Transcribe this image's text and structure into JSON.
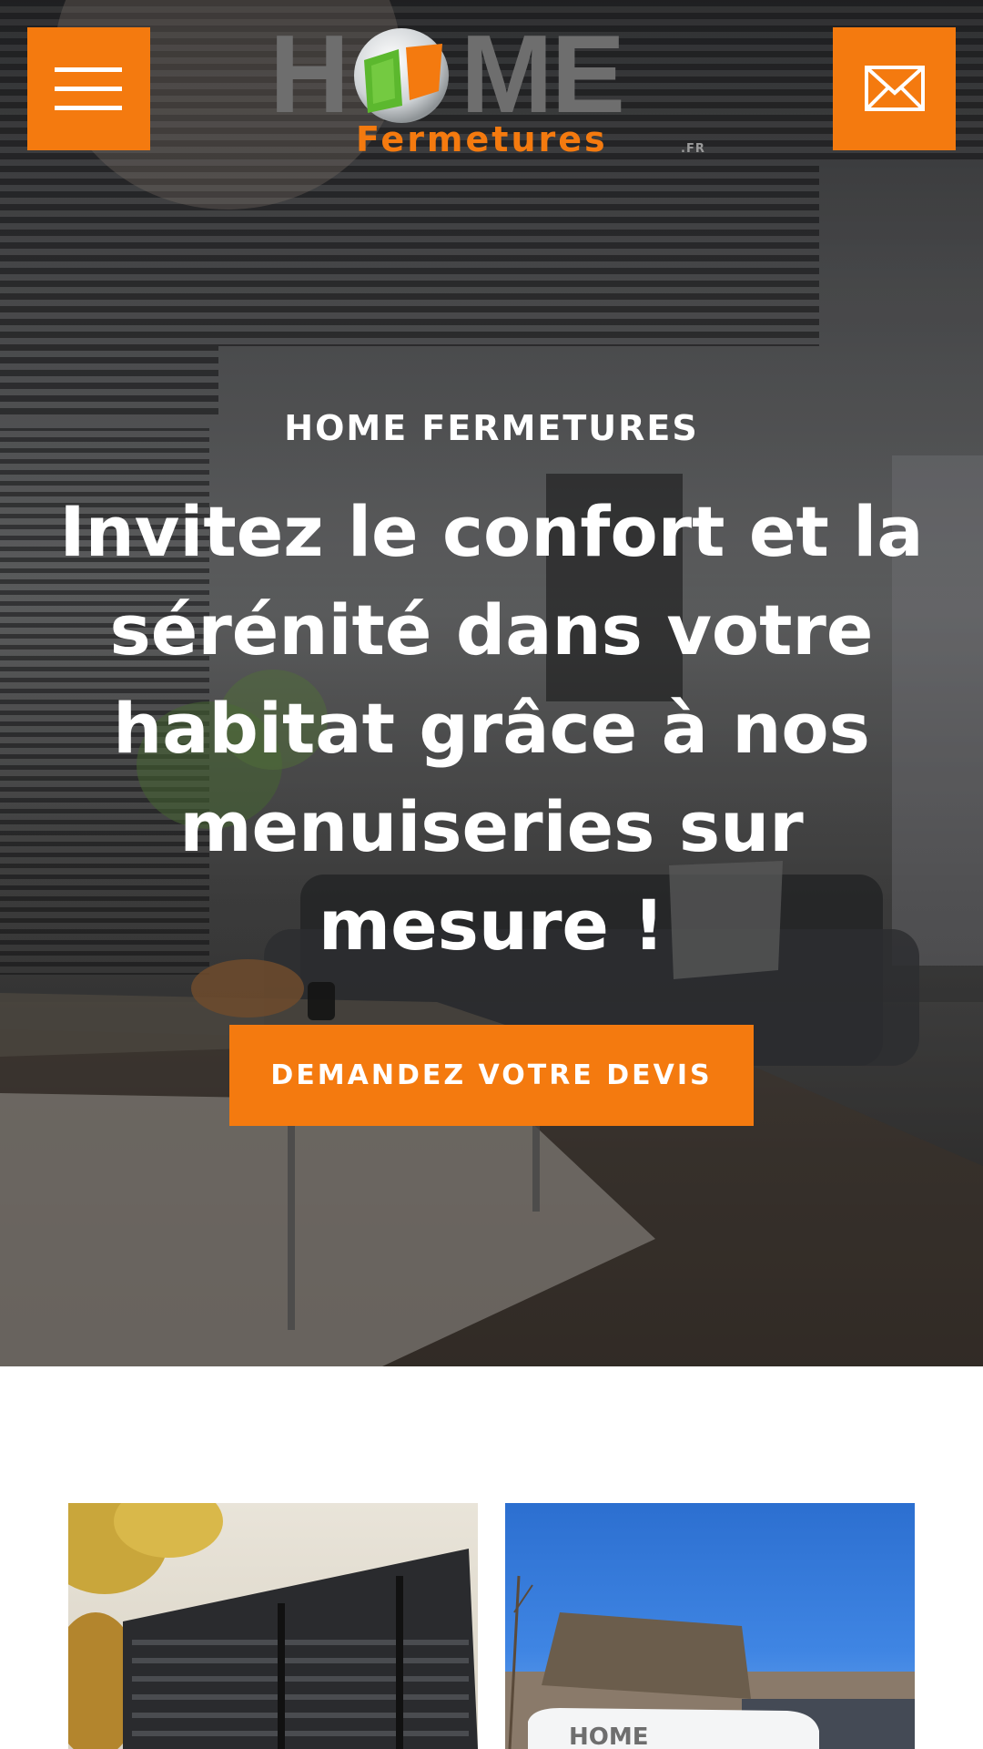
{
  "header": {
    "menu_icon": "hamburger-icon",
    "mail_icon": "envelope-icon",
    "logo": {
      "brand_home": "HOME",
      "brand_sub": "Fermetures",
      "brand_tld": ".FR"
    }
  },
  "hero": {
    "eyebrow": "HOME FERMETURES",
    "headline": "Invitez le confort et la sérénité dans votre habitat grâce à nos menuiseries sur mesure !",
    "cta_label": "DEMANDEZ VOTRE DEVIS"
  },
  "colors": {
    "accent": "#f47a0f",
    "logo_gray": "#6e6e6e",
    "text_on_hero": "#ffffff"
  },
  "cards": [
    {
      "image": "shutters-photo"
    },
    {
      "image": "van-photo",
      "van_logo_text": "HOME"
    }
  ]
}
